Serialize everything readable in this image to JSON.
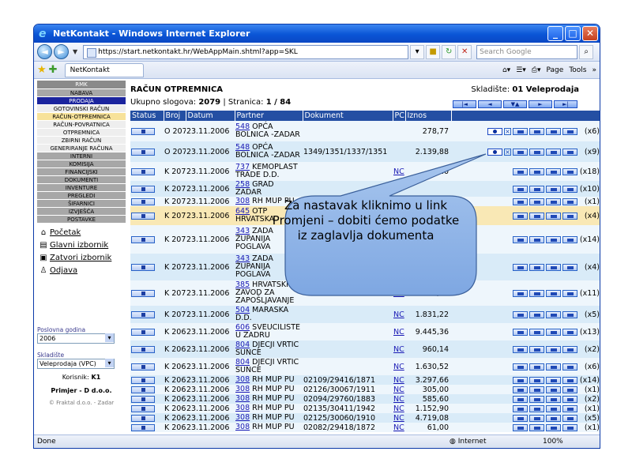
{
  "window": {
    "title": "NetKontakt - Windows Internet Explorer",
    "minimize": "_",
    "maximize": "□",
    "close": "✕"
  },
  "browser": {
    "url": "https://start.netkontakt.hr/WebAppMain.shtml?app=SKL",
    "search_placeholder": "Search Google",
    "tab_title": "NetKontakt",
    "page_menu": "Page",
    "tools_menu": "Tools",
    "more": "»"
  },
  "status": {
    "left": "Done",
    "zone": "Internet",
    "zoom": "100%"
  },
  "sidebar": {
    "menu": [
      {
        "label": "RMK",
        "style": "head"
      },
      {
        "label": "NABAVA",
        "style": "grey"
      },
      {
        "label": "PRODAJA",
        "style": "sel"
      },
      {
        "label": "GOTOVINSKI RAČUN",
        "style": "white"
      },
      {
        "label": "RAČUN-OTPREMNICA",
        "style": "yellow"
      },
      {
        "label": "RAČUN-POVRATNICA",
        "style": "white"
      },
      {
        "label": "OTPREMNICA",
        "style": "white"
      },
      {
        "label": "ZBIRNI RAČUN",
        "style": "white"
      },
      {
        "label": "GENERIRANJE RAČUNA",
        "style": "white"
      },
      {
        "label": "INTERNI",
        "style": "grey"
      },
      {
        "label": "KOMISIJA",
        "style": "grey"
      },
      {
        "label": "FINANCIJSKI",
        "style": "grey"
      },
      {
        "label": "DOKUMENTI",
        "style": "grey"
      },
      {
        "label": "INVENTURE",
        "style": "grey"
      },
      {
        "label": "PREGLEDI",
        "style": "grey"
      },
      {
        "label": "ŠIFARNICI",
        "style": "grey"
      },
      {
        "label": "IZVJEŠĆA",
        "style": "grey"
      },
      {
        "label": "POSTAVKE",
        "style": "grey"
      }
    ],
    "links": [
      "Početak",
      "Glavni izbornik",
      "Zatvori izbornik",
      "Odjava"
    ],
    "year_label": "Poslovna godina",
    "year_value": "2006",
    "warehouse_label": "Skladište",
    "warehouse_value": "Veleprodaja (VPC)",
    "user_label": "Korisnik:",
    "user_value": "K1",
    "company": "Primjer - D d.o.o.",
    "footer": "© Fraktal d.o.o. - Zadar"
  },
  "main": {
    "title": "RAČUN OTPREMNICA",
    "warehouse_label": "Skladište:",
    "warehouse_value": "01 Veleprodaja",
    "count_label": "Ukupno slogova:",
    "count_value": "2079",
    "page_label": "Stranica:",
    "page_value": "1 / 84",
    "pager": [
      "|◄",
      "◄",
      "▼▲",
      "►",
      "►|"
    ],
    "columns": [
      "Status",
      "Broj",
      "Datum",
      "Partner",
      "Dokument",
      "PC",
      "Iznos",
      ""
    ],
    "rows": [
      {
        "status": "O",
        "broj": "2079",
        "datum": "23.11.2006",
        "pid": "548",
        "pname": "OPĆA BOLNICA -ZADAR",
        "dok": "",
        "pc": "",
        "iznos": "278,77",
        "count": "(x6)",
        "kind": "o"
      },
      {
        "status": "O",
        "broj": "2078",
        "datum": "23.11.2006",
        "pid": "548",
        "pname": "OPĆA BOLNICA -ZADAR",
        "dok": "1349/1351/1337/1351",
        "pc": "",
        "iznos": "2.139,88",
        "count": "(x9)",
        "kind": "o"
      },
      {
        "status": "K",
        "broj": "2077",
        "datum": "23.11.2006",
        "pid": "737",
        "pname": "KEMOPLAST TRADE D.D.",
        "dok": "",
        "pc": "NC",
        "iznos": "2.0",
        "count": "(x18)",
        "kind": "k"
      },
      {
        "status": "K",
        "broj": "2076",
        "datum": "23.11.2006",
        "pid": "258",
        "pname": "GRAD ZADAR",
        "dok": "",
        "pc": "",
        "iznos": "",
        "count": "(x10)",
        "kind": "k"
      },
      {
        "status": "K",
        "broj": "2075",
        "datum": "23.11.2006",
        "pid": "308",
        "pname": "RH MUP PU",
        "dok": "",
        "pc": "",
        "iznos": "",
        "count": "(x1)",
        "kind": "k"
      },
      {
        "status": "K",
        "broj": "2074",
        "datum": "23.11.2006",
        "pid": "645",
        "pname": "OTP HRVATSKA",
        "dok": "",
        "pc": "",
        "iznos": "",
        "count": "(x4)",
        "kind": "k"
      },
      {
        "status": "K",
        "broj": "2073",
        "datum": "23.11.2006",
        "pid": "343",
        "pname": "ZADA ŽUPANIJA POGLAVA",
        "dok": "",
        "pc": "",
        "iznos": "",
        "count": "(x14)",
        "kind": "k"
      },
      {
        "status": "K",
        "broj": "2072",
        "datum": "23.11.2006",
        "pid": "343",
        "pname": "ZADA ŽUPANIJA POGLAVA",
        "dok": "",
        "pc": "",
        "iznos": "",
        "count": "(x4)",
        "kind": "k"
      },
      {
        "status": "K",
        "broj": "2071",
        "datum": "23.11.2006",
        "pid": "385",
        "pname": "HRVATSKI ZAVOD ZA ZAPOŠLJAVANJE",
        "dok": "",
        "pc": "NC",
        "iznos": "1.498,98",
        "count": "(x11)",
        "kind": "k"
      },
      {
        "status": "K",
        "broj": "2070",
        "datum": "23.11.2006",
        "pid": "504",
        "pname": "MARASKA D.D.",
        "dok": "",
        "pc": "NC",
        "iznos": "1.831,22",
        "count": "(x5)",
        "kind": "k"
      },
      {
        "status": "K",
        "broj": "2069",
        "datum": "23.11.2006",
        "pid": "606",
        "pname": "SVEUČILIŠTE U ZADRU",
        "dok": "",
        "pc": "NC",
        "iznos": "9.445,36",
        "count": "(x13)",
        "kind": "k"
      },
      {
        "status": "K",
        "broj": "2068",
        "datum": "23.11.2006",
        "pid": "804",
        "pname": "DJEČJI VRTIĆ SUNCE",
        "dok": "",
        "pc": "NC",
        "iznos": "960,14",
        "count": "(x2)",
        "kind": "k"
      },
      {
        "status": "K",
        "broj": "2067",
        "datum": "23.11.2006",
        "pid": "804",
        "pname": "DJEČJI VRTIĆ SUNCE",
        "dok": "",
        "pc": "NC",
        "iznos": "1.630,52",
        "count": "(x6)",
        "kind": "k"
      },
      {
        "status": "K",
        "broj": "2066",
        "datum": "23.11.2006",
        "pid": "308",
        "pname": "RH MUP PU",
        "dok": "02109/29416/1871",
        "pc": "NC",
        "iznos": "3.297,66",
        "count": "(x14)",
        "kind": "k"
      },
      {
        "status": "K",
        "broj": "2065",
        "datum": "23.11.2006",
        "pid": "308",
        "pname": "RH MUP PU",
        "dok": "02126/30067/1911",
        "pc": "NC",
        "iznos": "305,00",
        "count": "(x1)",
        "kind": "k"
      },
      {
        "status": "K",
        "broj": "2064",
        "datum": "23.11.2006",
        "pid": "308",
        "pname": "RH MUP PU",
        "dok": "02094/29760/1883",
        "pc": "NC",
        "iznos": "585,60",
        "count": "(x2)",
        "kind": "k"
      },
      {
        "status": "K",
        "broj": "2063",
        "datum": "23.11.2006",
        "pid": "308",
        "pname": "RH MUP PU",
        "dok": "02135/30411/1942",
        "pc": "NC",
        "iznos": "1.152,90",
        "count": "(x1)",
        "kind": "k"
      },
      {
        "status": "K",
        "broj": "2062",
        "datum": "23.11.2006",
        "pid": "308",
        "pname": "RH MUP PU",
        "dok": "02125/30060/1910",
        "pc": "NC",
        "iznos": "4.719,08",
        "count": "(x5)",
        "kind": "k"
      },
      {
        "status": "K",
        "broj": "2061",
        "datum": "23.11.2006",
        "pid": "308",
        "pname": "RH MUP PU",
        "dok": "02082/29418/1872",
        "pc": "NC",
        "iznos": "61,00",
        "count": "(x1)",
        "kind": "k"
      }
    ]
  },
  "callout": {
    "text": "Za nastavak kliknimo u link  Promjeni – dobiti ćemo podatke iz zaglavlja dokumenta"
  },
  "icons": [
    "ie-icon",
    "back-icon",
    "forward-icon",
    "lock-icon",
    "refresh-icon",
    "stop-icon",
    "search-icon",
    "star-icon",
    "home-icon",
    "feeds-icon",
    "print-icon",
    "home-link-icon",
    "menu-icon",
    "close-menu-icon",
    "logout-icon",
    "globe-icon"
  ]
}
